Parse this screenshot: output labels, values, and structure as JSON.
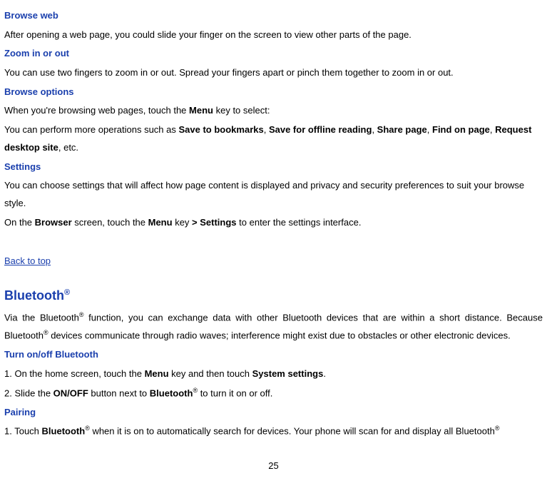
{
  "sections": {
    "browse_web": {
      "title": "Browse web",
      "para": "After opening a web page, you could slide your finger on the screen to view other parts of the page."
    },
    "zoom": {
      "title": "Zoom in or out",
      "para": "You can use two fingers to zoom in or out. Spread your fingers apart or pinch them together to zoom in or out."
    },
    "browse_options": {
      "title": "Browse options",
      "p1_prefix": "When you're browsing web pages, touch the ",
      "p1_bold1": "Menu",
      "p1_suffix": " key to select:",
      "p2_prefix": "You can perform more operations such as ",
      "p2_b1": "Save to bookmarks",
      "p2_sep1": ", ",
      "p2_b2": "Save for offline reading",
      "p2_sep2": ", ",
      "p2_b3": "Share page",
      "p2_sep3": ", ",
      "p2_b4": "Find on page",
      "p2_sep4": ", ",
      "p2_b5": "Request desktop site",
      "p2_suffix": ", etc."
    },
    "settings": {
      "title": "Settings",
      "p1": "You can choose settings that will affect how page content is displayed and privacy and security preferences to suit your browse style.",
      "p2_prefix": "On the ",
      "p2_b1": "Browser",
      "p2_mid1": " screen, touch the ",
      "p2_b2": "Menu",
      "p2_mid2": " key ",
      "p2_b3": "> Settings",
      "p2_suffix": " to enter the settings interface."
    },
    "back_link": "Back to top",
    "bluetooth": {
      "title": "Bluetooth",
      "title_sup": "®",
      "p1_prefix": "Via the Bluetooth",
      "p1_sup1": "®",
      "p1_mid": " function, you can exchange data with other Bluetooth devices that are within a short distance. Because Bluetooth",
      "p1_sup2": "®",
      "p1_suffix": " devices communicate through radio waves; interference might exist due to obstacles or other electronic devices."
    },
    "turn_onoff": {
      "title": "Turn on/off Bluetooth",
      "p1_prefix": "1. On the home screen, touch the ",
      "p1_b1": "Menu",
      "p1_mid": " key and then touch ",
      "p1_b2": "System settings",
      "p1_suffix": ".",
      "p2_prefix": "2. Slide the ",
      "p2_b1": "ON/OFF",
      "p2_mid": " button next to ",
      "p2_b2": "Bluetooth",
      "p2_sup": "®",
      "p2_suffix": " to turn it on or off."
    },
    "pairing": {
      "title": "Pairing",
      "p1_prefix": "1. Touch ",
      "p1_b1": "Bluetooth",
      "p1_sup1": "®",
      "p1_mid": " when it is on to automatically search for devices. Your phone will scan for and display all Bluetooth",
      "p1_sup2": "®"
    }
  },
  "page_number": "25"
}
